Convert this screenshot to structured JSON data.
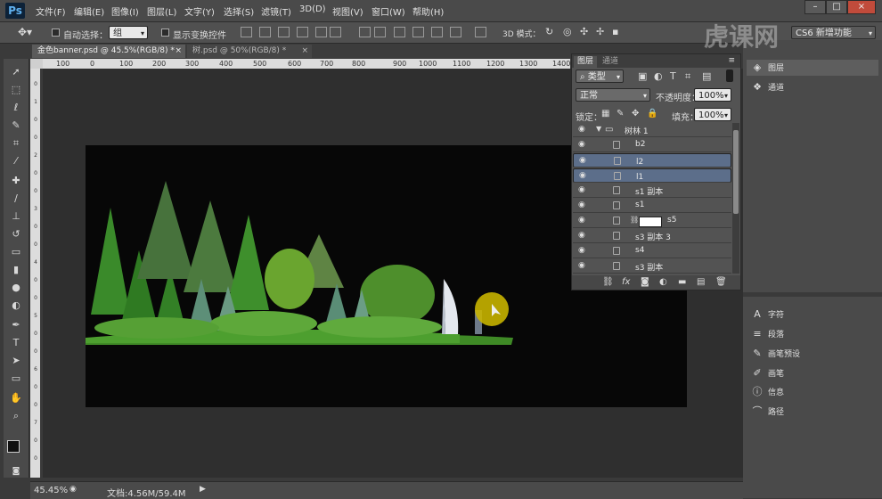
{
  "app": {
    "logo": "Ps"
  },
  "menu": [
    "文件(F)",
    "编辑(E)",
    "图像(I)",
    "图层(L)",
    "文字(Y)",
    "选择(S)",
    "滤镜(T)",
    "3D(D)",
    "视图(V)",
    "窗口(W)",
    "帮助(H)"
  ],
  "window_controls": {
    "minimize": "–",
    "maximize": "□",
    "close": "×"
  },
  "options": {
    "auto_select_label": "自动选择：",
    "auto_select_value": "组",
    "show_transform_label": "显示变换控件",
    "mode_3d_label": "3D 模式：",
    "workspace": "CS6 新增功能"
  },
  "doc_tabs": [
    {
      "label": "金色banner.psd @ 45.5%(RGB/8) *",
      "active": true
    },
    {
      "label": "树.psd @ 50%(RGB/8) *",
      "active": false
    }
  ],
  "ruler_top": [
    "100",
    "0",
    "100",
    "200",
    "300",
    "400",
    "500",
    "600",
    "700",
    "800",
    "900",
    "1000",
    "1100",
    "1200",
    "1300",
    "1400"
  ],
  "ruler_left": [
    "0",
    "1",
    "0",
    "0",
    "2",
    "0",
    "0",
    "3",
    "0",
    "0",
    "4",
    "0",
    "0",
    "5",
    "0",
    "0",
    "6",
    "0",
    "0",
    "7",
    "0",
    "0"
  ],
  "status": {
    "zoom": "45.45%",
    "doc": "文档:4.56M/59.4M"
  },
  "layers_panel": {
    "tabs": [
      "图层",
      "通道"
    ],
    "filter_label": "类型",
    "blend_mode": "正常",
    "opacity_label": "不透明度：",
    "opacity": "100%",
    "lock_label": "锁定：",
    "fill_label": "填充：",
    "fill": "100%",
    "group_name": "树林 1",
    "layers": [
      {
        "name": "b2",
        "selected": false
      },
      {
        "name": "l2",
        "selected": true
      },
      {
        "name": "l1",
        "selected": true
      },
      {
        "name": "s1 副本",
        "selected": false
      },
      {
        "name": "s1",
        "selected": false
      },
      {
        "name": "s5",
        "selected": false,
        "masked": true
      },
      {
        "name": "s3 副本 3",
        "selected": false
      },
      {
        "name": "s4",
        "selected": false
      },
      {
        "name": "s3 副本",
        "selected": false
      }
    ],
    "footer_icons": [
      "link-icon",
      "fx-icon",
      "mask-icon",
      "adjustment-icon",
      "folder-icon",
      "new-layer-icon",
      "trash-icon"
    ]
  },
  "dock_top": [
    {
      "label": "图层",
      "icon": "layers-icon",
      "active": true
    },
    {
      "label": "通道",
      "icon": "channels-icon",
      "active": false
    }
  ],
  "dock_bottom": [
    {
      "label": "字符",
      "icon": "character-icon"
    },
    {
      "label": "段落",
      "icon": "paragraph-icon"
    },
    {
      "label": "画笔预设",
      "icon": "brush-preset-icon"
    },
    {
      "label": "画笔",
      "icon": "brush-icon"
    },
    {
      "label": "信息",
      "icon": "info-icon"
    },
    {
      "label": "路径",
      "icon": "paths-icon"
    }
  ],
  "watermark": "虎课网",
  "colors": {
    "accent_selected": "#5c6e8a",
    "cursor_highlight": "#c8b400"
  }
}
